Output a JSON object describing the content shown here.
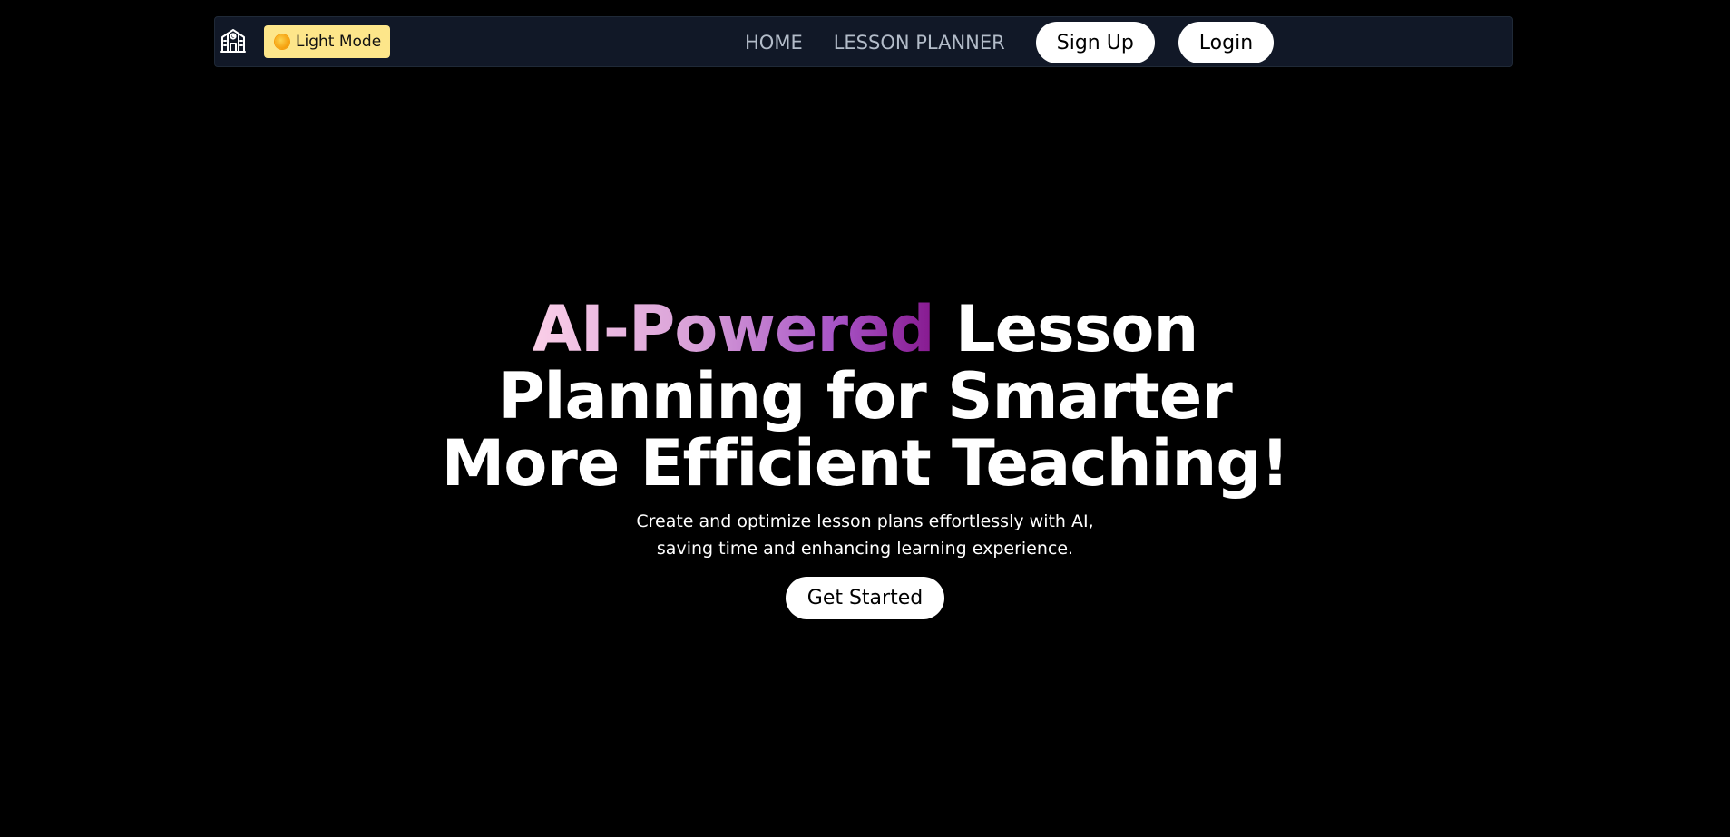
{
  "nav": {
    "logo_icon": "school-building-icon",
    "mode_toggle": {
      "icon": "sun-icon",
      "label": "Light Mode"
    },
    "links": [
      {
        "label": "HOME"
      },
      {
        "label": "LESSON PLANNER"
      }
    ],
    "signup_label": "Sign Up",
    "login_label": "Login"
  },
  "hero": {
    "title_highlight": "AI-Powered",
    "title_rest": " Lesson Planning for Smarter More Efficient Teaching!",
    "subtitle_line1": "Create and optimize lesson plans effortlessly with AI,",
    "subtitle_line2": "saving time and enhancing learning experience.",
    "cta_label": "Get Started"
  },
  "colors": {
    "background": "#000000",
    "navbar_bg": "#111827",
    "toggle_bg": "#fde68a",
    "nav_link": "#b3bcc9",
    "gradient_start": "#fbcfe8",
    "gradient_end": "#86198f"
  }
}
